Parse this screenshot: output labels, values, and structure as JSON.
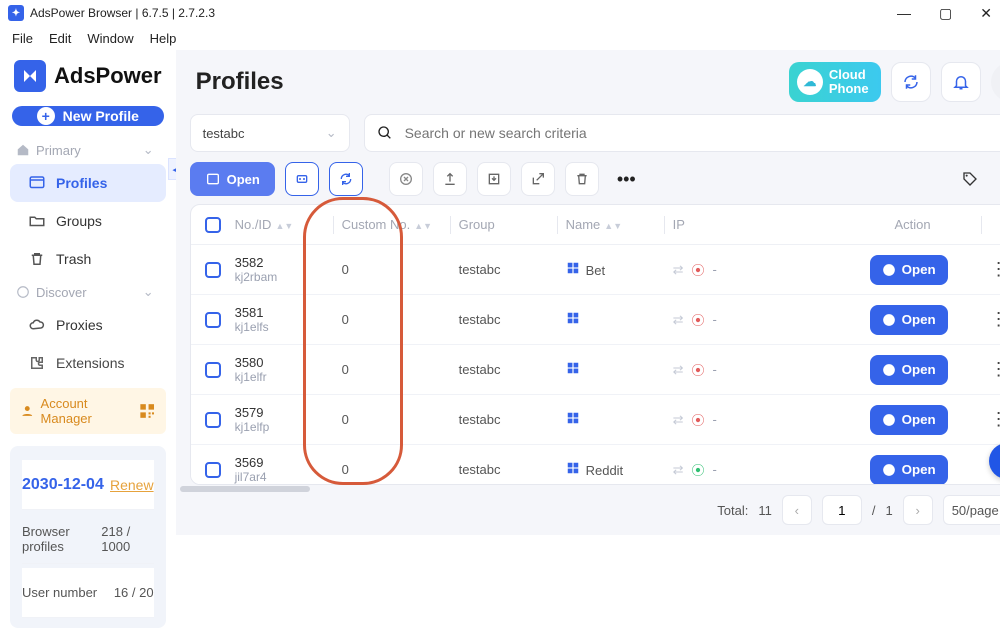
{
  "window": {
    "title": "AdsPower Browser | 6.7.5 | 2.7.2.3"
  },
  "menus": {
    "file": "File",
    "edit": "Edit",
    "window": "Window",
    "help": "Help"
  },
  "brand": {
    "name": "AdsPower"
  },
  "buttons": {
    "new_profile": "New Profile",
    "open": "Open"
  },
  "sections": {
    "primary": "Primary",
    "discover": "Discover"
  },
  "nav": {
    "profiles": "Profiles",
    "groups": "Groups",
    "trash": "Trash",
    "proxies": "Proxies",
    "extensions": "Extensions"
  },
  "account_manager": "Account Manager",
  "footer": {
    "date": "2030-12-04",
    "renew": "Renew",
    "bp_label": "Browser profiles",
    "bp_value": "218 / 1000",
    "un_label": "User number",
    "un_value": "16 / 20"
  },
  "page": {
    "title": "Profiles"
  },
  "cloudphone": {
    "line1": "Cloud",
    "line2": "Phone"
  },
  "group_select": {
    "value": "testabc"
  },
  "search": {
    "placeholder": "Search or new search criteria"
  },
  "columns": {
    "id": "No./ID",
    "custom": "Custom No.",
    "group": "Group",
    "name": "Name",
    "ip": "IP",
    "action": "Action"
  },
  "rows": [
    {
      "id": "3582",
      "sub": "kj2rbam",
      "custom": "0",
      "group": "testabc",
      "name": "Bet",
      "pin": "red"
    },
    {
      "id": "3581",
      "sub": "kj1elfs",
      "custom": "0",
      "group": "testabc",
      "name": "",
      "pin": "red"
    },
    {
      "id": "3580",
      "sub": "kj1elfr",
      "custom": "0",
      "group": "testabc",
      "name": "",
      "pin": "red"
    },
    {
      "id": "3579",
      "sub": "kj1elfp",
      "custom": "0",
      "group": "testabc",
      "name": "",
      "pin": "red"
    },
    {
      "id": "3569",
      "sub": "jil7ar4",
      "custom": "0",
      "group": "testabc",
      "name": "Reddit",
      "pin": "green"
    }
  ],
  "pager": {
    "total_label": "Total:",
    "total": "11",
    "page": "1",
    "pages": "1",
    "perpage": "50/page",
    "sep": "/"
  }
}
